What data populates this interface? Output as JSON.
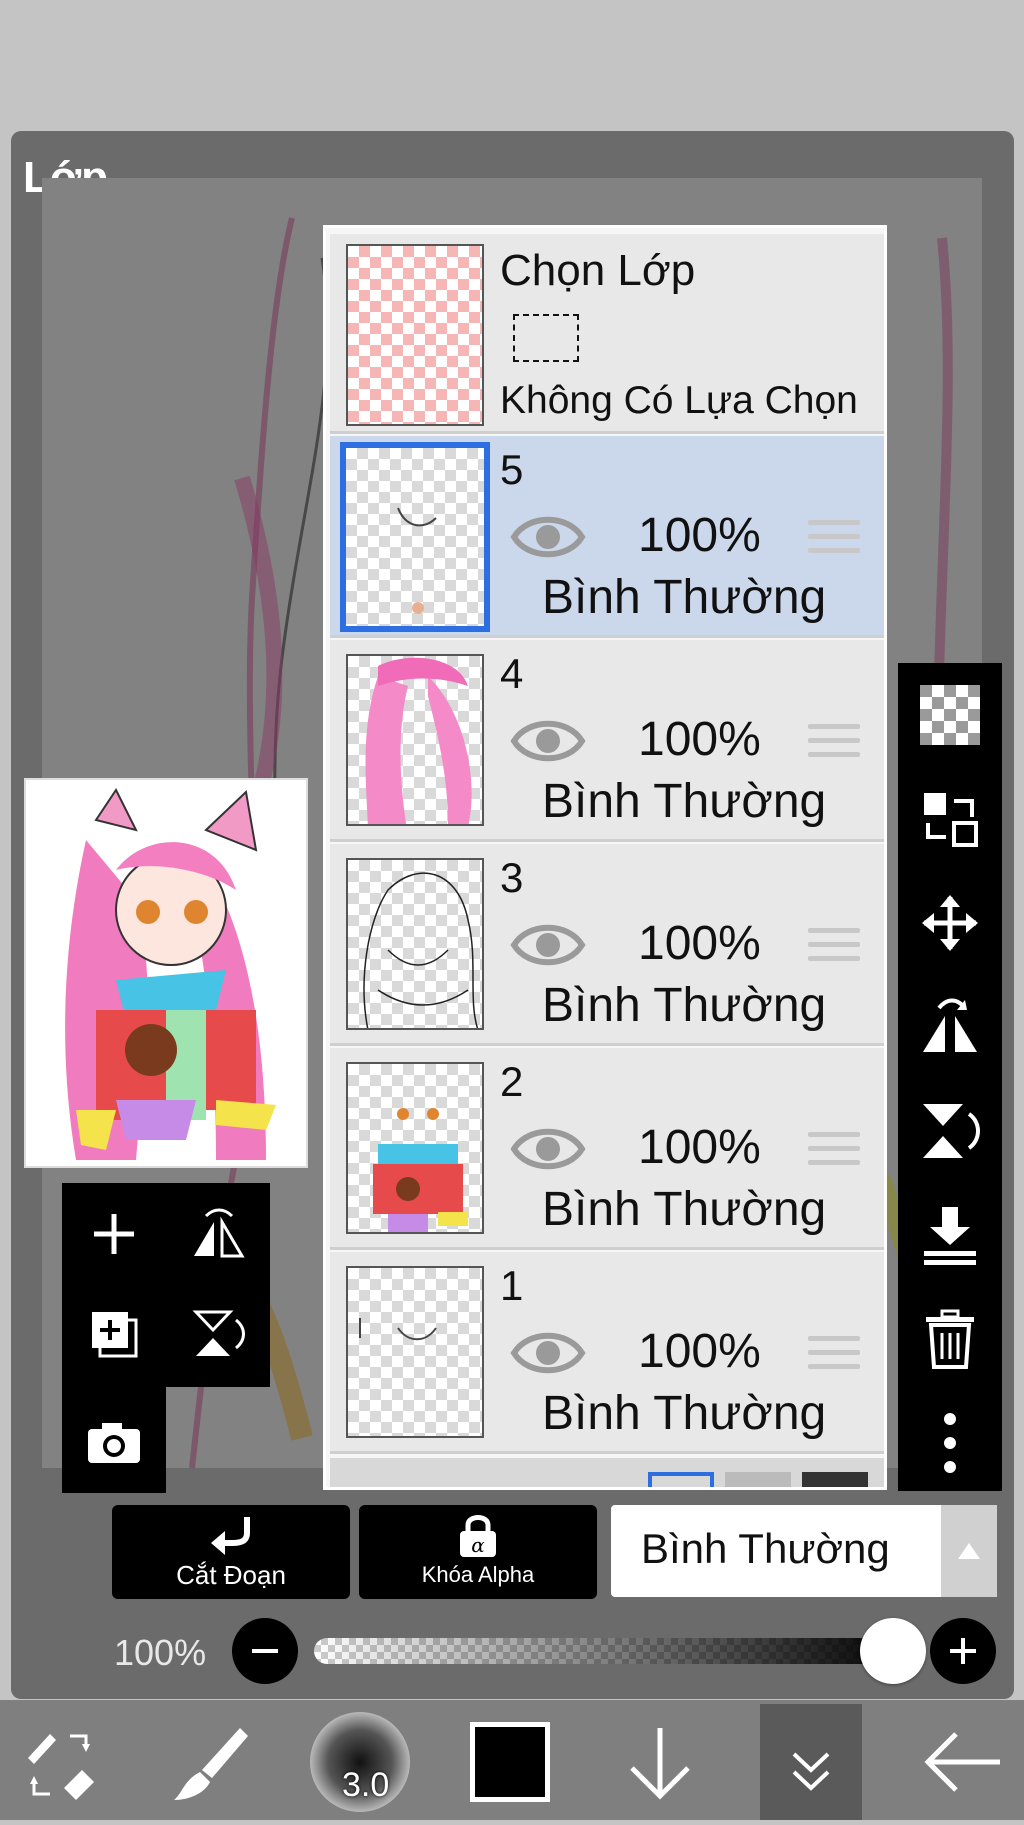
{
  "panel": {
    "title": "Lớp"
  },
  "selection_layer": {
    "title": "Chọn Lớp",
    "status": "Không Có Lựa Chọn"
  },
  "layers": [
    {
      "number": "5",
      "opacity": "100%",
      "blend": "Bình Thường",
      "selected": true
    },
    {
      "number": "4",
      "opacity": "100%",
      "blend": "Bình Thường",
      "selected": false
    },
    {
      "number": "3",
      "opacity": "100%",
      "blend": "Bình Thường",
      "selected": false
    },
    {
      "number": "2",
      "opacity": "100%",
      "blend": "Bình Thường",
      "selected": false
    },
    {
      "number": "1",
      "opacity": "100%",
      "blend": "Bình Thường",
      "selected": false
    }
  ],
  "actions": {
    "clip_label": "Cắt Đoạn",
    "alpha_lock_label": "Khóa Alpha",
    "blend_mode_value": "Bình Thường"
  },
  "opacity_control": {
    "label": "100%",
    "value": 1.0
  },
  "bottom_toolbar": {
    "brush_size": "3.0",
    "current_color": "#000000"
  },
  "left_toolbar_icons": [
    "plus-icon",
    "flip-horizontal-icon",
    "duplicate-layer-icon",
    "flip-vertical-icon",
    "camera-icon"
  ],
  "right_toolbar_icons": [
    "transparent-bg-icon",
    "swap-layer-icon",
    "move-icon",
    "flip-horizontal-icon",
    "flip-vertical-icon",
    "merge-down-icon",
    "trash-icon",
    "more-icon"
  ],
  "colors": {
    "panel_bg": "#6b6b6b",
    "selected_row": "#cbd7ea",
    "selected_border": "#2d6ee0",
    "bottom_bar": "#7f7f7f"
  }
}
